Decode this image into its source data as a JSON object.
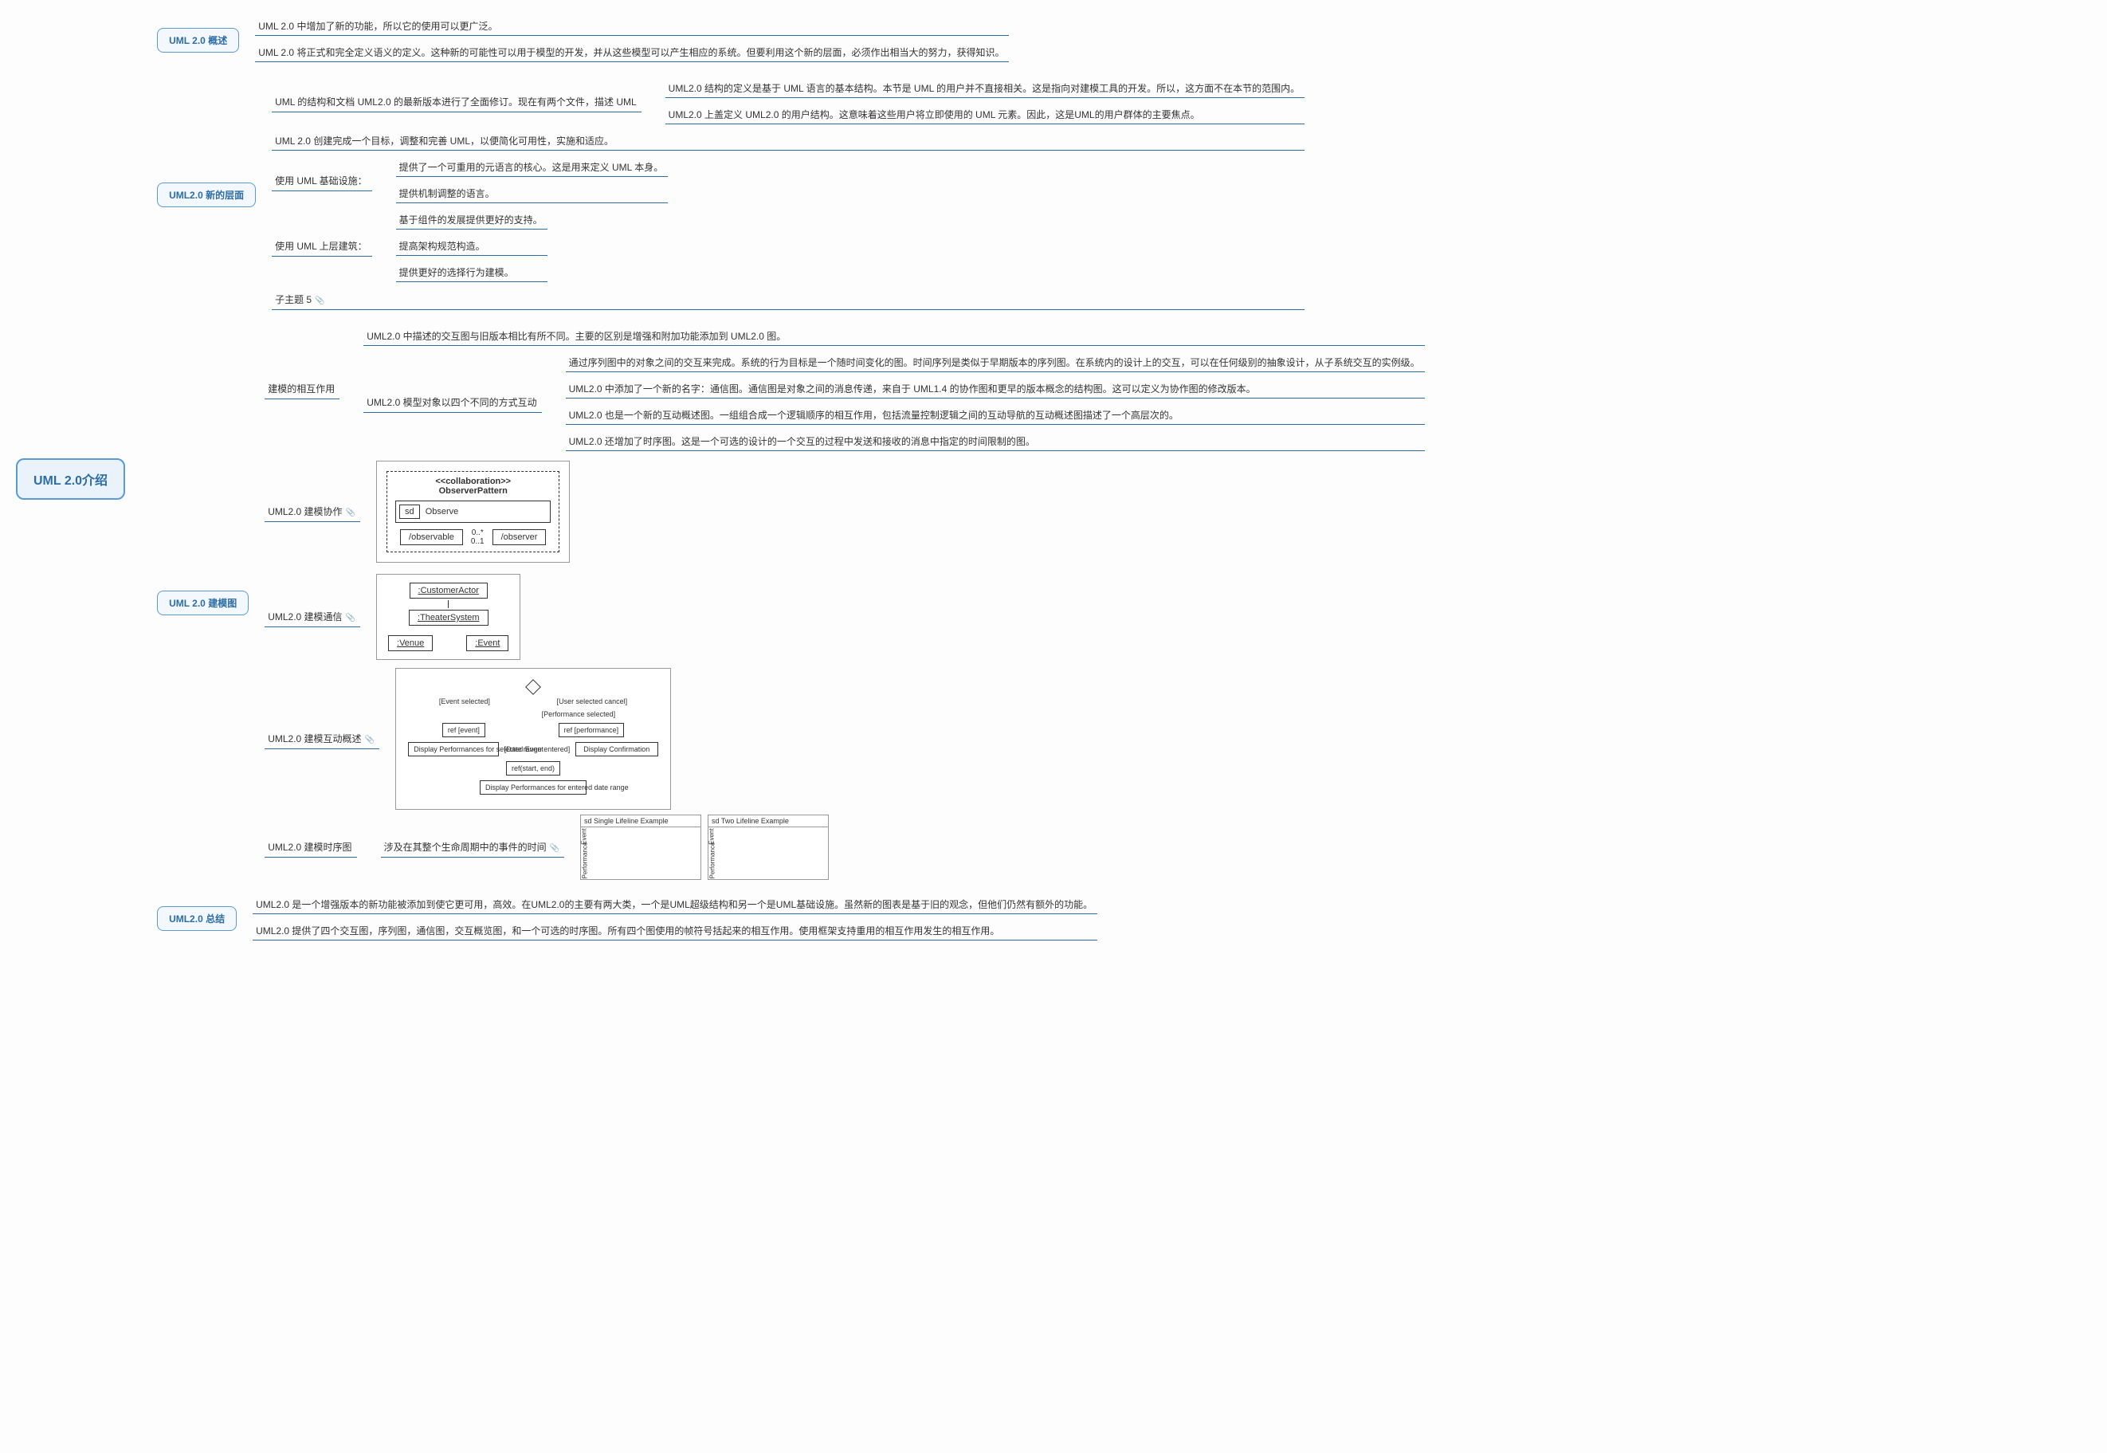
{
  "root": "UML 2.0介绍",
  "b1": {
    "title": "UML 2.0 概述",
    "n1": "UML 2.0 中增加了新的功能，所以它的使用可以更广泛。",
    "n2": "UML 2.0 将正式和完全定义语义的定义。这种新的可能性可以用于模型的开发，并从这些模型可以产生相应的系统。但要利用这个新的层面，必须作出相当大的努力，获得知识。"
  },
  "b2": {
    "title": "UML2.0 新的层面",
    "n1": "UML 的结构和文档 UML2.0 的最新版本进行了全面修订。现在有两个文件，描述 UML",
    "n1a": "UML2.0 结构的定义是基于 UML 语言的基本结构。本节是 UML 的用户并不直接相关。这是指向对建模工具的开发。所以，这方面不在本节的范围内。",
    "n1b": "UML2.0 上盖定义 UML2.0 的用户结构。这意味着这些用户将立即使用的 UML 元素。因此，这是UML的用户群体的主要焦点。",
    "n2": "UML 2.0 创建完成一个目标，调整和完善 UML，以便简化可用性，实施和适应。",
    "n3": "使用 UML 基础设施：",
    "n3a": "提供了一个可重用的元语言的核心。这是用来定义 UML 本身。",
    "n3b": "提供机制调整的语言。",
    "n4": "使用 UML 上层建筑：",
    "n4a": "基于组件的发展提供更好的支持。",
    "n4b": "提高架构规范构造。",
    "n4c": "提供更好的选择行为建模。",
    "n5": "子主题 5"
  },
  "b3": {
    "title": "UML 2.0 建模图",
    "s1": "建模的相互作用",
    "s1n1": "UML2.0 中描述的交互图与旧版本相比有所不同。主要的区别是增强和附加功能添加到 UML2.0 图。",
    "s1n2": "UML2.0 模型对象以四个不同的方式互动",
    "s1n2a": "通过序列图中的对象之间的交互来完成。系统的行为目标是一个随时间变化的图。时间序列是类似于早期版本的序列图。在系统内的设计上的交互，可以在任何级别的抽象设计，从子系统交互的实例级。",
    "s1n2b": "UML2.0 中添加了一个新的名字：通信图。通信图是对象之间的消息传递，来自于 UML1.4 的协作图和更早的版本概念的结构图。这可以定义为协作图的修改版本。",
    "s1n2c": "UML2.0 也是一个新的互动概述图。一组组合成一个逻辑顺序的相互作用，包括流量控制逻辑之间的互动导航的互动概述图描述了一个高层次的。",
    "s1n2d": "UML2.0 还增加了时序图。这是一个可选的设计的一个交互的过程中发送和接收的消息中指定的时间限制的图。",
    "s2": "UML2.0 建模协作",
    "s3": "UML2.0 建模通信",
    "s4": "UML2.0 建模互动概述",
    "s5": "UML2.0 建模时序图",
    "s5n": "涉及在其整个生命周期中的事件的时间"
  },
  "b4": {
    "title": "UML2.0 总结",
    "n1": "UML2.0 是一个增强版本的新功能被添加到使它更可用，高效。在UML2.0的主要有两大类，一个是UML超级结构和另一个是UML基础设施。虽然新的图表是基于旧的观念，但他们仍然有额外的功能。",
    "n2": "UML2.0 提供了四个交互图，序列图，通信图，交互概览图，和一个可选的时序图。所有四个图使用的帧符号括起来的相互作用。使用框架支持重用的相互作用发生的相互作用。"
  },
  "d1": {
    "title": "<<collaboration>>",
    "name": "ObserverPattern",
    "sd": "sd",
    "obs": "Observe",
    "left": "/observable",
    "right": "/observer",
    "mult1": "0..*",
    "mult2": "0..1"
  },
  "d2": {
    "a": ":CustomerActor",
    "b": ":TheaterSystem",
    "c": ":Venue",
    "d": ":Event"
  },
  "d3": {
    "cond1": "[User selected cancel]",
    "cond2": "[Event selected]",
    "cond3": "[Performance selected]",
    "ref1": "ref [event]",
    "ref2": "ref [performance]",
    "box1": "Display Performances for selected Event",
    "box2": "Display Confirmation",
    "box3": "Display Performances for entered date range",
    "date": "[Date range entered]",
    "refstart": "ref(start, end)"
  },
  "d4": {
    "h1": "sd Single Lifeline Example",
    "h2": "sd Two Lifeline Example",
    "l1": "Event",
    "l2": "Performance"
  },
  "watermark": ""
}
